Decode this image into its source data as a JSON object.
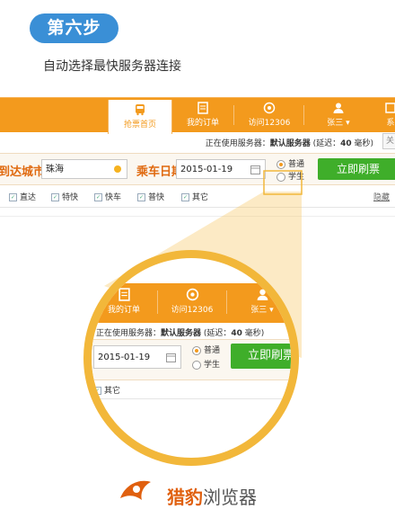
{
  "step_badge": "第六步",
  "subtitle": "自动选择最快服务器连接",
  "app": {
    "nav": [
      {
        "label": "抢票首页",
        "icon": "bus-icon"
      },
      {
        "label": "我的订单",
        "icon": "orders-icon"
      },
      {
        "label": "访问12306",
        "icon": "globe-icon"
      },
      {
        "label": "张三",
        "icon": "user-icon"
      },
      {
        "label": "系",
        "icon": "settings-icon"
      }
    ],
    "status_prefix": "正在使用服务器：",
    "status_server": "默认服务器",
    "status_latency_prefix": " (延迟：",
    "status_latency": "40",
    "status_latency_suffix": " 毫秒)",
    "close_label": "关",
    "dest_label": "到达城市",
    "dest_value": "珠海",
    "date_label": "乘车日期",
    "date_value": "2015-01-19",
    "radio_normal": "普通",
    "radio_student": "学生",
    "refresh_button": "立即刷票",
    "filters": [
      "直达",
      "特快",
      "快车",
      "普快",
      "其它"
    ],
    "hide_label": "隐藏"
  },
  "zoom": {
    "nav": [
      {
        "label": "我的订单",
        "icon": "orders-icon"
      },
      {
        "label": "访问12306",
        "icon": "globe-icon"
      },
      {
        "label": "张三",
        "icon": "user-icon"
      }
    ],
    "status_prefix": "正在使用服务器：",
    "status_server": "默认服务器",
    "status_latency_prefix": " (延迟：",
    "status_latency": "40",
    "status_latency_suffix": " 毫秒)",
    "date_value": "2015-01-19",
    "radio_normal": "普通",
    "radio_student": "学生",
    "refresh_button": "立即刷票",
    "filter_other": "其它"
  },
  "brand": {
    "name": "猎豹",
    "suffix": "浏览器"
  },
  "colors": {
    "accent_orange": "#f39a1d",
    "step_blue": "#3a8fd6",
    "button_green": "#3fae2a",
    "lens_gold": "#f2b73a"
  }
}
